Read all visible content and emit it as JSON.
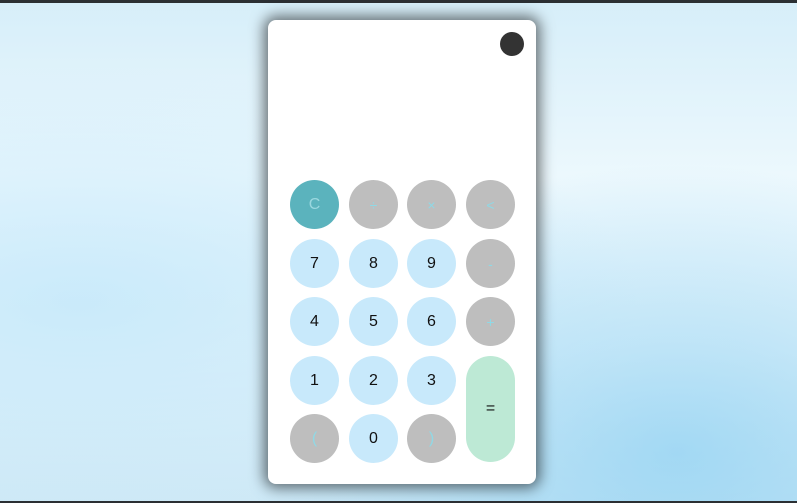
{
  "calculator": {
    "display": "",
    "keys": {
      "clear": "C",
      "divide": "÷",
      "multiply": "×",
      "backspace": "<",
      "seven": "7",
      "eight": "8",
      "nine": "9",
      "subtract": "-",
      "four": "4",
      "five": "5",
      "six": "6",
      "add": "+",
      "one": "1",
      "two": "2",
      "three": "3",
      "equals": "=",
      "open_paren": "(",
      "zero": "0",
      "close_paren": ")"
    }
  },
  "colors": {
    "clear_key": "#5bb3bd",
    "operator_key": "#bebebe",
    "number_key": "#c8e9fb",
    "equals_key": "#bde9d5",
    "theme_toggle": "#333333"
  }
}
